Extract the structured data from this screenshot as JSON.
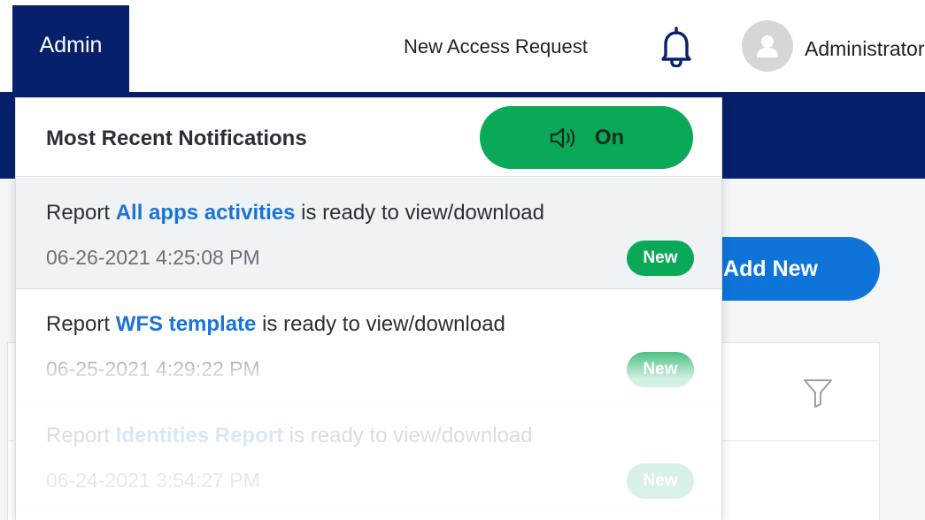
{
  "header": {
    "admin_tab": "Admin",
    "new_access_request": "New Access Request",
    "user_name": "Administrator"
  },
  "icons": {
    "bell": "bell-icon",
    "avatar": "user-avatar-icon",
    "speaker": "speaker-icon",
    "filter": "filter-icon"
  },
  "colors": {
    "navy": "#06206b",
    "green": "#0aa957",
    "blue": "#0f74da",
    "link": "#1a73d9"
  },
  "background": {
    "add_button": "Add New"
  },
  "notifications": {
    "title": "Most Recent Notifications",
    "sound_toggle": "On",
    "items": [
      {
        "prefix": "Report",
        "report": "All apps activities",
        "suffix": "is ready to view/download",
        "time": "06-26-2021 4:25:08 PM",
        "badge": "New"
      },
      {
        "prefix": "Report",
        "report": "WFS template",
        "suffix": "is ready to view/download",
        "time": "06-25-2021 4:29:22 PM",
        "badge": "New"
      },
      {
        "prefix": "Report",
        "report": "Identities Report",
        "suffix": "is ready to view/download",
        "time": "06-24-2021 3:54:27 PM",
        "badge": "New"
      }
    ]
  }
}
